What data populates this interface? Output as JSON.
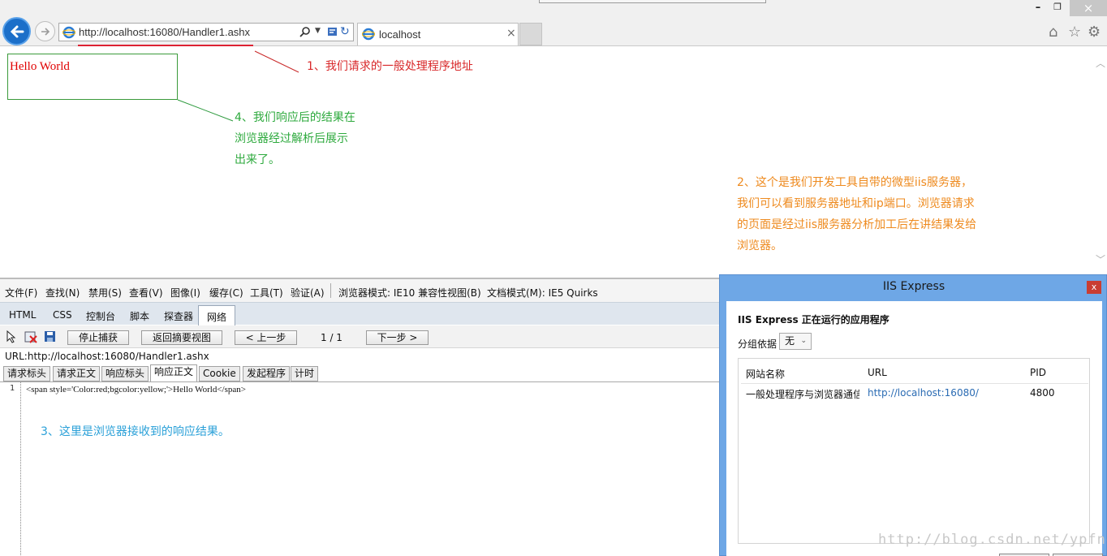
{
  "browser": {
    "address_url": "http://localhost:16080/Handler1.ashx",
    "tab_title": "localhost"
  },
  "page": {
    "hello_text": "Hello World"
  },
  "annotations": {
    "a1": "1、我们请求的一般处理程序地址",
    "a4_lines": [
      "4、我们响应后的结果在",
      "浏览器经过解析后展示",
      "出来了。"
    ],
    "a2_lines": [
      "2、这个是我们开发工具自带的微型iis服务器，",
      "我们可以看到服务器地址和ip端口。浏览器请求",
      "的页面是经过iis服务器分析加工后在讲结果发给",
      "浏览器。"
    ],
    "a3": "3、这里是浏览器接收到的响应结果。"
  },
  "devtools": {
    "menu": [
      "文件(F)",
      "查找(N)",
      "禁用(S)",
      "查看(V)",
      "图像(I)",
      "缓存(C)",
      "工具(T)",
      "验证(A)",
      "浏览器模式: IE10 兼容性视图(B)",
      "文档模式(M): IE5 Quirks"
    ],
    "tabs": [
      "HTML",
      "CSS",
      "控制台",
      "脚本",
      "探查器",
      "网络"
    ],
    "toolbar": {
      "stop_capture": "停止捕获",
      "back_summary": "返回摘要视图",
      "prev": "< 上一步",
      "pager": "1 / 1",
      "next": "下一步 >"
    },
    "url_line": "URL:http://localhost:16080/Handler1.ashx",
    "subtabs": [
      "请求标头",
      "请求正文",
      "响应标头",
      "响应正文",
      "Cookie",
      "发起程序",
      "计时"
    ],
    "line_number": "1",
    "code": "<span style='Color:red;bgcolor:yellow;'>Hello World</span>"
  },
  "iis": {
    "title": "IIS Express",
    "close": "x",
    "heading": "IIS Express 正在运行的应用程序",
    "group_label": "分组依据",
    "group_value": "无",
    "columns": [
      "网站名称",
      "URL",
      "PID"
    ],
    "row": {
      "name": "一般处理程序与浏览器通信",
      "url": "http://localhost:16080/",
      "pid": "4800"
    }
  },
  "watermark": "http://blog.csdn.net/ypfnet"
}
